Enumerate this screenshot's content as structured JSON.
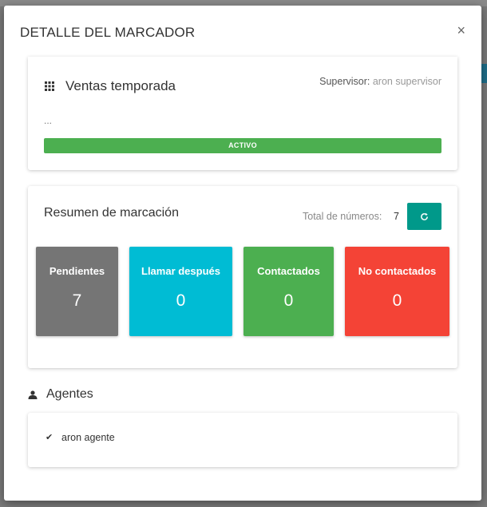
{
  "modal": {
    "title": "DETALLE DEL MARCADOR",
    "close_label": "×"
  },
  "campaign": {
    "name": "Ventas temporada",
    "supervisor_label": "Supervisor:",
    "supervisor_name": "aron supervisor",
    "description": "...",
    "status": "ACTIVO",
    "status_color": "#4caf50"
  },
  "summary": {
    "title": "Resumen de marcación",
    "total_label": "Total de números:",
    "total_value": "7",
    "tiles": [
      {
        "label": "Pendientes",
        "count": "7",
        "color": "#757575"
      },
      {
        "label": "Llamar después",
        "count": "0",
        "color": "#00bcd4"
      },
      {
        "label": "Contactados",
        "count": "0",
        "color": "#4caf50"
      },
      {
        "label": "No contactados",
        "count": "0",
        "color": "#f44336"
      }
    ]
  },
  "agents": {
    "title": "Agentes",
    "list": [
      {
        "name": "aron agente"
      }
    ]
  },
  "colors": {
    "accent": "#00998a",
    "backdrop": "#7a7a7a"
  },
  "icons": [
    "grid-icon",
    "refresh-icon",
    "person-icon",
    "check-icon",
    "close-icon"
  ]
}
